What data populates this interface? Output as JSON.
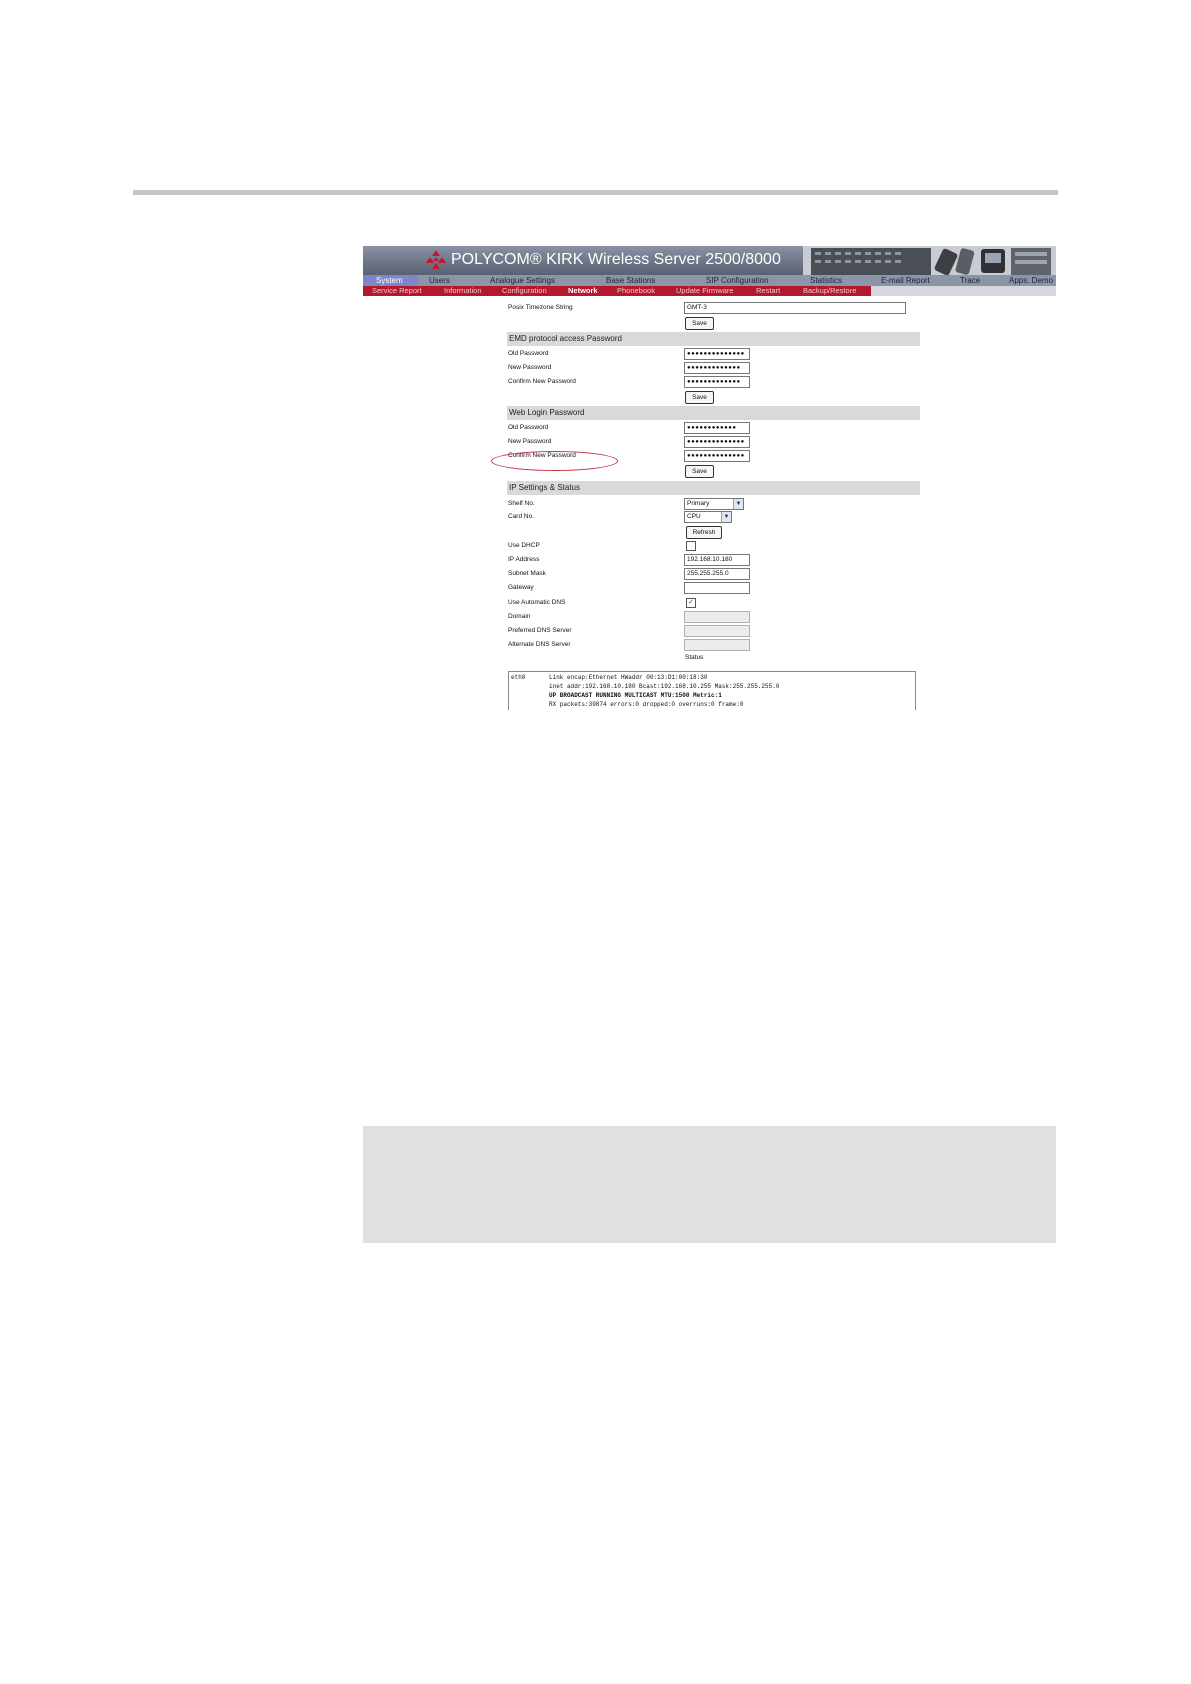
{
  "app": {
    "brand_title": "POLYCOM® KIRK Wireless Server 2500/8000"
  },
  "nav_primary": [
    "System",
    "Users",
    "Analogue Settings",
    "Base Stations",
    "SIP Configuration",
    "Statistics",
    "E-mail Report",
    "Trace",
    "Apps. Demo"
  ],
  "nav_secondary": [
    "Service Report",
    "Information",
    "Configuration",
    "Network",
    "Phonebook",
    "Update Firmware",
    "Restart",
    "Backup/Restore"
  ],
  "posix": {
    "label": "Posix Timezone String",
    "value": "GMT-3",
    "save": "Save"
  },
  "emd_section": {
    "title": "EMD protocol access Password",
    "old_label": "Old Password",
    "new_label": "New Password",
    "confirm_label": "Confirm New Password",
    "old_value": "●●●●●●●●●●●●●●",
    "new_value": "●●●●●●●●●●●●●",
    "confirm_value": "●●●●●●●●●●●●●",
    "save": "Save"
  },
  "web_section": {
    "title": "Web Login Password",
    "old_label": "Old Password",
    "new_label": "New Password",
    "confirm_label": "Confirm New Password",
    "old_value": "●●●●●●●●●●●●",
    "new_value": "●●●●●●●●●●●●●●",
    "confirm_value": "●●●●●●●●●●●●●●",
    "save": "Save"
  },
  "ip_section": {
    "title": "IP Settings & Status",
    "shelf_label": "Shelf No.",
    "shelf_value": "Primary",
    "card_label": "Card No.",
    "card_value": "CPU",
    "refresh": "Refresh",
    "dhcp_label": "Use DHCP",
    "ip_label": "IP Address",
    "ip_value": "192.168.10.180",
    "mask_label": "Subnet Mask",
    "mask_value": "255.255.255.0",
    "gateway_label": "Gateway",
    "gateway_value": "",
    "auto_dns_label": "Use Automatic DNS",
    "domain_label": "Domain",
    "pref_dns_label": "Preferred DNS Server",
    "alt_dns_label": "Alternate DNS Server",
    "status_label": "Status"
  },
  "status_output": {
    "iface": "eth0",
    "line1": "Link encap:Ethernet  HWaddr 00:13:D1:00:18:30",
    "line2": "inet addr:192.168.10.180  Bcast:192.168.10.255  Mask:255.255.255.0",
    "line3": "UP BROADCAST RUNNING MULTICAST  MTU:1500  Metric:1",
    "line4": "RX packets:39874 errors:0 dropped:0 overruns:0 frame:0"
  }
}
